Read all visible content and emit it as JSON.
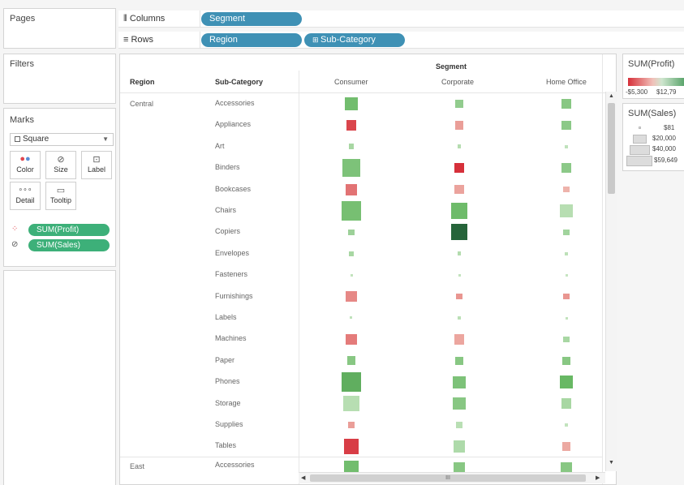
{
  "left": {
    "pages_title": "Pages",
    "filters_title": "Filters",
    "marks": {
      "title": "Marks",
      "mark_type": "Square",
      "buttons": [
        "Color",
        "Size",
        "Label",
        "Detail",
        "Tooltip"
      ],
      "pills": [
        "SUM(Profit)",
        "SUM(Sales)"
      ]
    }
  },
  "shelves": {
    "columns_label": "Columns",
    "rows_label": "Rows",
    "columns_pills": [
      "Segment"
    ],
    "rows_pills": [
      "Region",
      "Sub-Category"
    ]
  },
  "view": {
    "column_header": "Segment",
    "row_header_region": "Region",
    "row_header_subcat": "Sub-Category",
    "segments": [
      "Consumer",
      "Corporate",
      "Home Office"
    ],
    "regions": [
      "Central",
      "East"
    ],
    "subcategories": [
      "Accessories",
      "Appliances",
      "Art",
      "Binders",
      "Bookcases",
      "Chairs",
      "Copiers",
      "Envelopes",
      "Fasteners",
      "Furnishings",
      "Labels",
      "Machines",
      "Paper",
      "Phones",
      "Storage",
      "Supplies",
      "Tables"
    ],
    "east_first_row": "Accessories",
    "scroll_thumb_label": "III"
  },
  "chart_data": {
    "type": "heatmap",
    "mark_type": "square",
    "x_field": "Segment",
    "row_fields": [
      "Region",
      "Sub-Category"
    ],
    "color_measure": "SUM(Profit)",
    "size_measure": "SUM(Sales)",
    "columns": [
      "Consumer",
      "Corporate",
      "Home Office"
    ],
    "color_colors": {
      "negative": "#d6303a",
      "positive": "#2e8b45"
    },
    "rows": [
      {
        "region": "Central",
        "subcategory": "Accessories",
        "cells": [
          {
            "profit": 4000,
            "sales": 15000
          },
          {
            "profit": 2500,
            "sales": 6000
          },
          {
            "profit": 3000,
            "sales": 9000
          }
        ]
      },
      {
        "region": "Central",
        "subcategory": "Appliances",
        "cells": [
          {
            "profit": -4500,
            "sales": 11000
          },
          {
            "profit": -1200,
            "sales": 7000
          },
          {
            "profit": 2800,
            "sales": 9000
          }
        ]
      },
      {
        "region": "Central",
        "subcategory": "Art",
        "cells": [
          {
            "profit": 1500,
            "sales": 3000
          },
          {
            "profit": 900,
            "sales": 1500
          },
          {
            "profit": 400,
            "sales": 1000
          }
        ]
      },
      {
        "region": "Central",
        "subcategory": "Binders",
        "cells": [
          {
            "profit": 3500,
            "sales": 32000
          },
          {
            "profit": -5300,
            "sales": 10000
          },
          {
            "profit": 2800,
            "sales": 9000
          }
        ]
      },
      {
        "region": "Central",
        "subcategory": "Bookcases",
        "cells": [
          {
            "profit": -2800,
            "sales": 13000
          },
          {
            "profit": -1000,
            "sales": 9000
          },
          {
            "profit": -400,
            "sales": 4000
          }
        ]
      },
      {
        "region": "Central",
        "subcategory": "Chairs",
        "cells": [
          {
            "profit": 3800,
            "sales": 40000
          },
          {
            "profit": 4200,
            "sales": 24000
          },
          {
            "profit": 800,
            "sales": 15000
          }
        ]
      },
      {
        "region": "Central",
        "subcategory": "Copiers",
        "cells": [
          {
            "profit": 2000,
            "sales": 4000
          },
          {
            "profit": 12790,
            "sales": 27000
          },
          {
            "profit": 1800,
            "sales": 3500
          }
        ]
      },
      {
        "region": "Central",
        "subcategory": "Envelopes",
        "cells": [
          {
            "profit": 1500,
            "sales": 2500
          },
          {
            "profit": 1000,
            "sales": 1500
          },
          {
            "profit": 500,
            "sales": 1000
          }
        ]
      },
      {
        "region": "Central",
        "subcategory": "Fasteners",
        "cells": [
          {
            "profit": 300,
            "sales": 400
          },
          {
            "profit": 300,
            "sales": 300
          },
          {
            "profit": 100,
            "sales": 150
          }
        ]
      },
      {
        "region": "Central",
        "subcategory": "Furnishings",
        "cells": [
          {
            "profit": -2000,
            "sales": 12000
          },
          {
            "profit": -1500,
            "sales": 3500
          },
          {
            "profit": -1500,
            "sales": 3500
          }
        ]
      },
      {
        "region": "Central",
        "subcategory": "Labels",
        "cells": [
          {
            "profit": 400,
            "sales": 600
          },
          {
            "profit": 600,
            "sales": 1000
          },
          {
            "profit": 300,
            "sales": 500
          }
        ]
      },
      {
        "region": "Central",
        "subcategory": "Machines",
        "cells": [
          {
            "profit": -2500,
            "sales": 12000
          },
          {
            "profit": -900,
            "sales": 10000
          },
          {
            "profit": 1500,
            "sales": 4000
          }
        ]
      },
      {
        "region": "Central",
        "subcategory": "Paper",
        "cells": [
          {
            "profit": 3000,
            "sales": 8000
          },
          {
            "profit": 3000,
            "sales": 7000
          },
          {
            "profit": 3000,
            "sales": 6000
          }
        ]
      },
      {
        "region": "Central",
        "subcategory": "Phones",
        "cells": [
          {
            "profit": 5500,
            "sales": 37000
          },
          {
            "profit": 3500,
            "sales": 15000
          },
          {
            "profit": 4500,
            "sales": 17000
          }
        ]
      },
      {
        "region": "Central",
        "subcategory": "Storage",
        "cells": [
          {
            "profit": 800,
            "sales": 25000
          },
          {
            "profit": 3000,
            "sales": 15000
          },
          {
            "profit": 1500,
            "sales": 10000
          }
        ]
      },
      {
        "region": "Central",
        "subcategory": "Supplies",
        "cells": [
          {
            "profit": -1200,
            "sales": 4000
          },
          {
            "profit": 700,
            "sales": 4000
          },
          {
            "profit": 300,
            "sales": 700
          }
        ]
      },
      {
        "region": "Central",
        "subcategory": "Tables",
        "cells": [
          {
            "profit": -4800,
            "sales": 23000
          },
          {
            "profit": 1200,
            "sales": 14000
          },
          {
            "profit": -800,
            "sales": 8000
          }
        ]
      },
      {
        "region": "East",
        "subcategory": "Accessories",
        "cells": [
          {
            "profit": 4000,
            "sales": 20000
          },
          {
            "profit": 3000,
            "sales": 12000
          },
          {
            "profit": 3000,
            "sales": 12000
          }
        ]
      }
    ]
  },
  "legends": {
    "profit": {
      "title": "SUM(Profit)",
      "min_label": "-$5,300",
      "max_label": "$12,79"
    },
    "sales": {
      "title": "SUM(Sales)",
      "entries": [
        "$81",
        "$20,000",
        "$40,000",
        "$59,649"
      ]
    }
  }
}
